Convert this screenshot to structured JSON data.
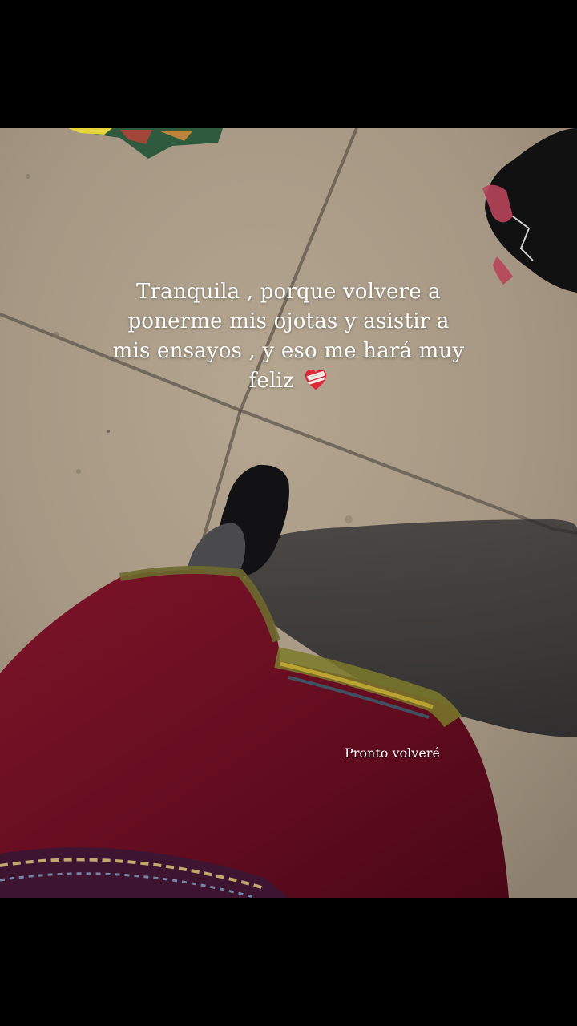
{
  "story": {
    "caption": {
      "line1": "Tranquila , porque volvere  a",
      "line2": "ponerme mis ojotas y asistir a",
      "line3": "mis ensayos  , y eso me hará muy",
      "line4": "feliz"
    },
    "caption_emoji": "mending-heart-icon",
    "subcaption": "Pronto volveré"
  },
  "colors": {
    "letterbox": "#000000",
    "floor": "#a89a86",
    "skirt": "#6e1024",
    "text": "#ffffff"
  }
}
